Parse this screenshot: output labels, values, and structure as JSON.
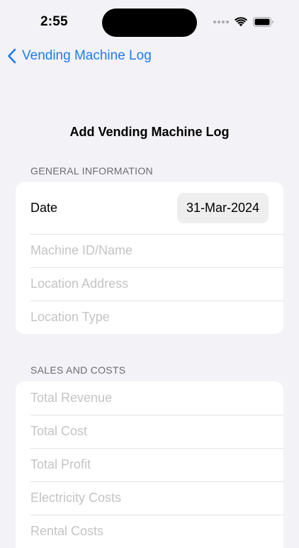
{
  "status_bar": {
    "time": "2:55",
    "icons": [
      "cellular-signal-icon",
      "wifi-icon",
      "battery-icon"
    ]
  },
  "nav": {
    "back_label": "Vending Machine Log",
    "accent_color": "#1E7CF2"
  },
  "page": {
    "title": "Add Vending Machine Log"
  },
  "general_information": {
    "header": "GENERAL INFORMATION",
    "date_label": "Date",
    "date_value": "31-Mar-2024",
    "machine_id_placeholder": "Machine ID/Name",
    "location_address_placeholder": "Location Address",
    "location_type_placeholder": "Location Type"
  },
  "sales_and_costs": {
    "header": "SALES AND COSTS",
    "total_revenue_placeholder": "Total Revenue",
    "total_cost_placeholder": "Total Cost",
    "total_profit_placeholder": "Total Profit",
    "electricity_costs_placeholder": "Electricity Costs",
    "rental_costs_placeholder": "Rental Costs"
  }
}
